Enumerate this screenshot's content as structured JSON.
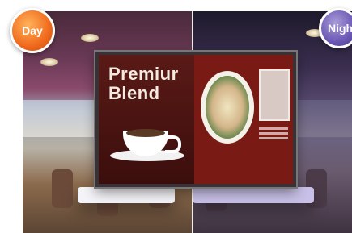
{
  "badges": {
    "day_label": "Day",
    "night_label": "Nigh",
    "day_color": "#f06a1d",
    "night_color": "#6b57b4"
  },
  "screen": {
    "title_line1": "Premiur",
    "title_line2": "Blend"
  }
}
